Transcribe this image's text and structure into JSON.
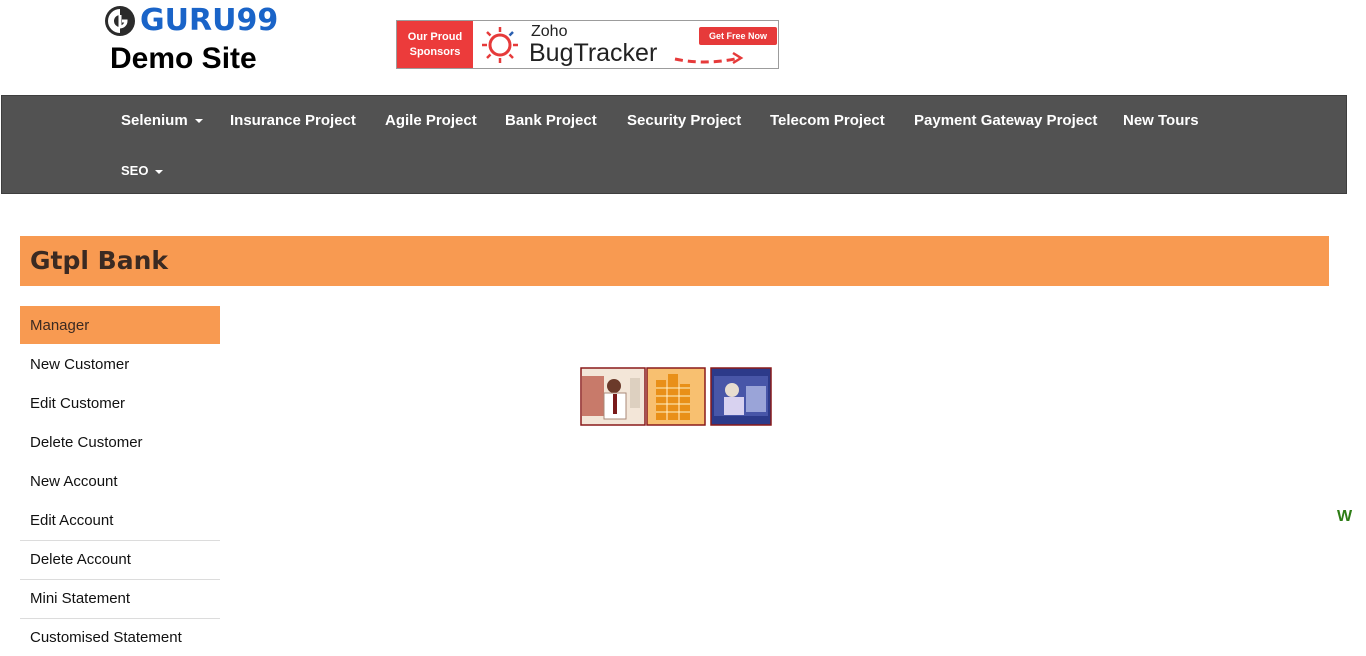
{
  "site": {
    "brand": "GURU99",
    "subtitle": "Demo Site"
  },
  "banner": {
    "sponsor_line1": "Our Proud",
    "sponsor_line2": "Sponsors",
    "product_small": "Zoho",
    "product_big": "BugTracker",
    "cta": "Get Free Now"
  },
  "nav": {
    "items": [
      {
        "label": "Selenium",
        "dropdown": true
      },
      {
        "label": "Insurance Project"
      },
      {
        "label": "Agile Project"
      },
      {
        "label": "Bank Project"
      },
      {
        "label": "Security Project"
      },
      {
        "label": "Telecom Project"
      },
      {
        "label": "Payment Gateway Project"
      },
      {
        "label": "New Tours"
      },
      {
        "label": "SEO",
        "dropdown": true
      }
    ]
  },
  "page": {
    "title": "Gtpl Bank"
  },
  "sidebar": {
    "items": [
      {
        "label": "Manager",
        "active": true
      },
      {
        "label": "New Customer"
      },
      {
        "label": "Edit Customer"
      },
      {
        "label": "Delete Customer"
      },
      {
        "label": "New Account"
      },
      {
        "label": "Edit Account"
      },
      {
        "label": "Delete Account"
      },
      {
        "label": "Mini Statement"
      },
      {
        "label": "Customised Statement"
      }
    ]
  },
  "marquee": {
    "text": "W"
  },
  "colors": {
    "accent": "#f89a51",
    "nav_bg": "#525252",
    "brand_blue": "#1a64c8",
    "sponsor_red": "#ec3b3b",
    "marquee_green": "#2e7d16"
  },
  "icons": {
    "logo": "guru99-logo-icon",
    "banner_logo": "bugtracker-sun-icon"
  }
}
